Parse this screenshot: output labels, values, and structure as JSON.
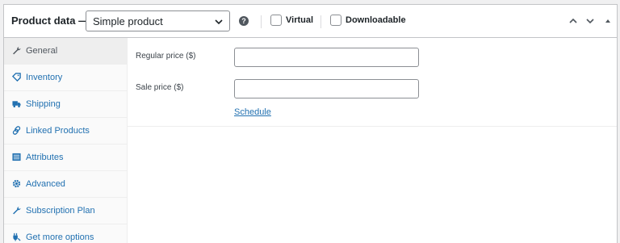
{
  "header": {
    "title": "Product data —",
    "product_type": "Simple product",
    "help_glyph": "?",
    "virtual_label": "Virtual",
    "downloadable_label": "Downloadable"
  },
  "tabs": [
    {
      "label": "General",
      "icon": "wrench-icon",
      "active": true
    },
    {
      "label": "Inventory",
      "icon": "tag-icon"
    },
    {
      "label": "Shipping",
      "icon": "truck-icon"
    },
    {
      "label": "Linked Products",
      "icon": "link-icon"
    },
    {
      "label": "Attributes",
      "icon": "list-icon"
    },
    {
      "label": "Advanced",
      "icon": "gear-icon"
    },
    {
      "label": "Subscription Plan",
      "icon": "wrench-icon"
    },
    {
      "label": "Get more options",
      "icon": "plugin-icon"
    }
  ],
  "general": {
    "regular_price_label": "Regular price ($)",
    "regular_price_value": "",
    "sale_price_label": "Sale price ($)",
    "sale_price_value": "",
    "schedule_link": "Schedule"
  },
  "colors": {
    "link": "#2271b1",
    "border": "#c3c4c7",
    "tab_active_bg": "#eeeeee",
    "tab_bg": "#fafafa"
  }
}
